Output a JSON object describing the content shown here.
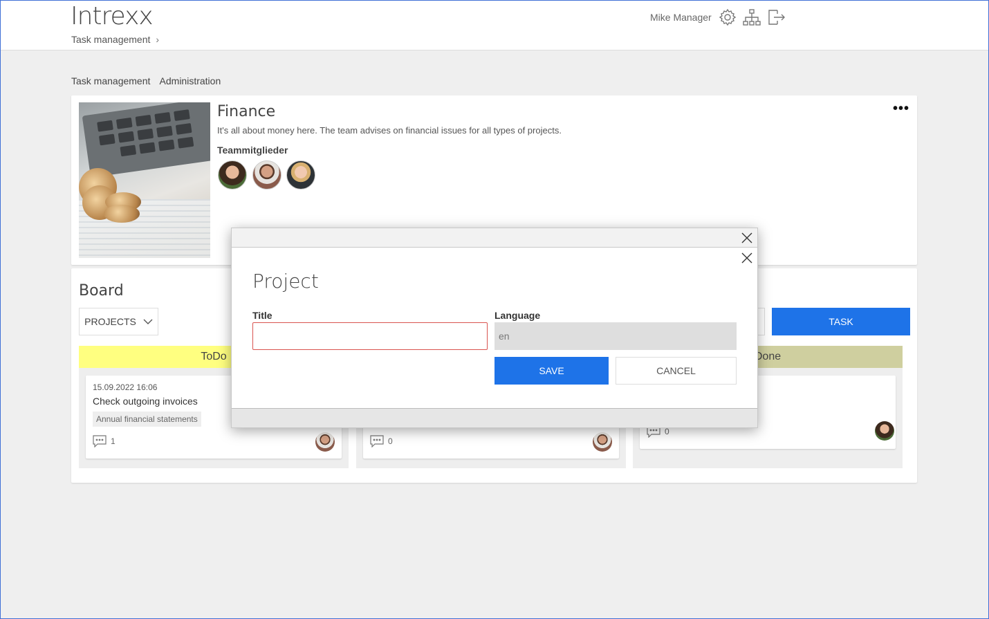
{
  "header": {
    "logo": "Intrexx",
    "breadcrumb": "Task management",
    "user_name": "Mike Manager",
    "icons": [
      "gear-icon",
      "sitemap-icon",
      "logout-icon"
    ]
  },
  "sub_nav": {
    "items": [
      "Task management",
      "Administration"
    ]
  },
  "team": {
    "title": "Finance",
    "description": "It's all about money here. The team advises on financial issues for all types of projects.",
    "members_label": "Teammitglieder",
    "more_label": "•••"
  },
  "board": {
    "title": "Board",
    "projects_label": "PROJECTS",
    "task_button": "TASK",
    "columns": [
      {
        "name": "ToDo",
        "color": "#ffff80"
      },
      {
        "name": "",
        "color": "#eeeeee"
      },
      {
        "name": "Done",
        "color": "#cfcf9f"
      }
    ],
    "tasks": [
      {
        "date": "15.09.2022 16:06",
        "title": "Check outgoing invoices",
        "tag": "Annual financial statements",
        "comments": "1"
      },
      {
        "comments": "0"
      },
      {
        "comments": "0"
      }
    ]
  },
  "dialog": {
    "title": "Project",
    "title_label": "Title",
    "title_value": "",
    "language_label": "Language",
    "language_value": "en",
    "save_label": "SAVE",
    "cancel_label": "CANCEL"
  },
  "colors": {
    "accent": "#1e73e8",
    "error_border": "#d9534f"
  }
}
